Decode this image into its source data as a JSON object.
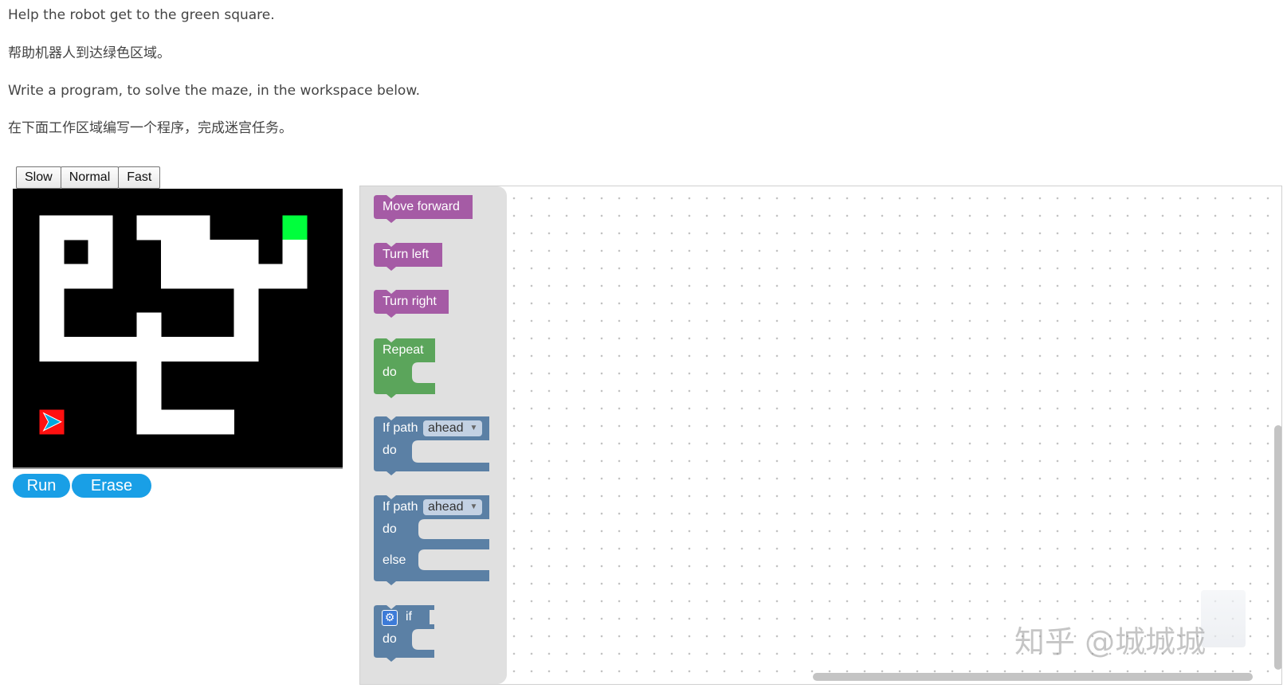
{
  "instructions": {
    "en_line1": "Help the robot get to the green square.",
    "zh_line1": "帮助机器人到达绿色区域。",
    "en_line2": "Write a program, to solve the maze, in the workspace below.",
    "zh_line2": "在下面工作区域编写一个程序，完成迷宫任务。"
  },
  "speed_buttons": {
    "slow": "Slow",
    "normal": "Normal",
    "fast": "Fast"
  },
  "controls": {
    "run": "Run",
    "erase": "Erase"
  },
  "maze": {
    "grid": [
      "0000000000000",
      "0111011100020",
      "0101001111010",
      "0111001111110",
      "0100000001000",
      "0100010001000",
      "0111111111000",
      "0000010000000",
      "0000010000000",
      "0300011110000",
      "0000000000000"
    ],
    "colors": {
      "wall": "#000000",
      "path": "#ffffff",
      "goal": "#00ff3c",
      "start": "#ff1010",
      "robot": "#00a8e0"
    }
  },
  "toolbox": {
    "move_forward": "Move forward",
    "turn_left": "Turn left",
    "turn_right": "Turn right",
    "repeat": "Repeat",
    "repeat_do": "do",
    "if_path": "If path",
    "if_option": "ahead",
    "if_do": "do",
    "ifelse_path": "If path",
    "ifelse_option": "ahead",
    "ifelse_do": "do",
    "ifelse_else": "else",
    "custom_if": "if",
    "custom_do": "do",
    "colors": {
      "motion": "#a55ba5",
      "loop": "#5ba55b",
      "logic": "#5b80a5"
    }
  },
  "watermark": "知乎 @城城城"
}
